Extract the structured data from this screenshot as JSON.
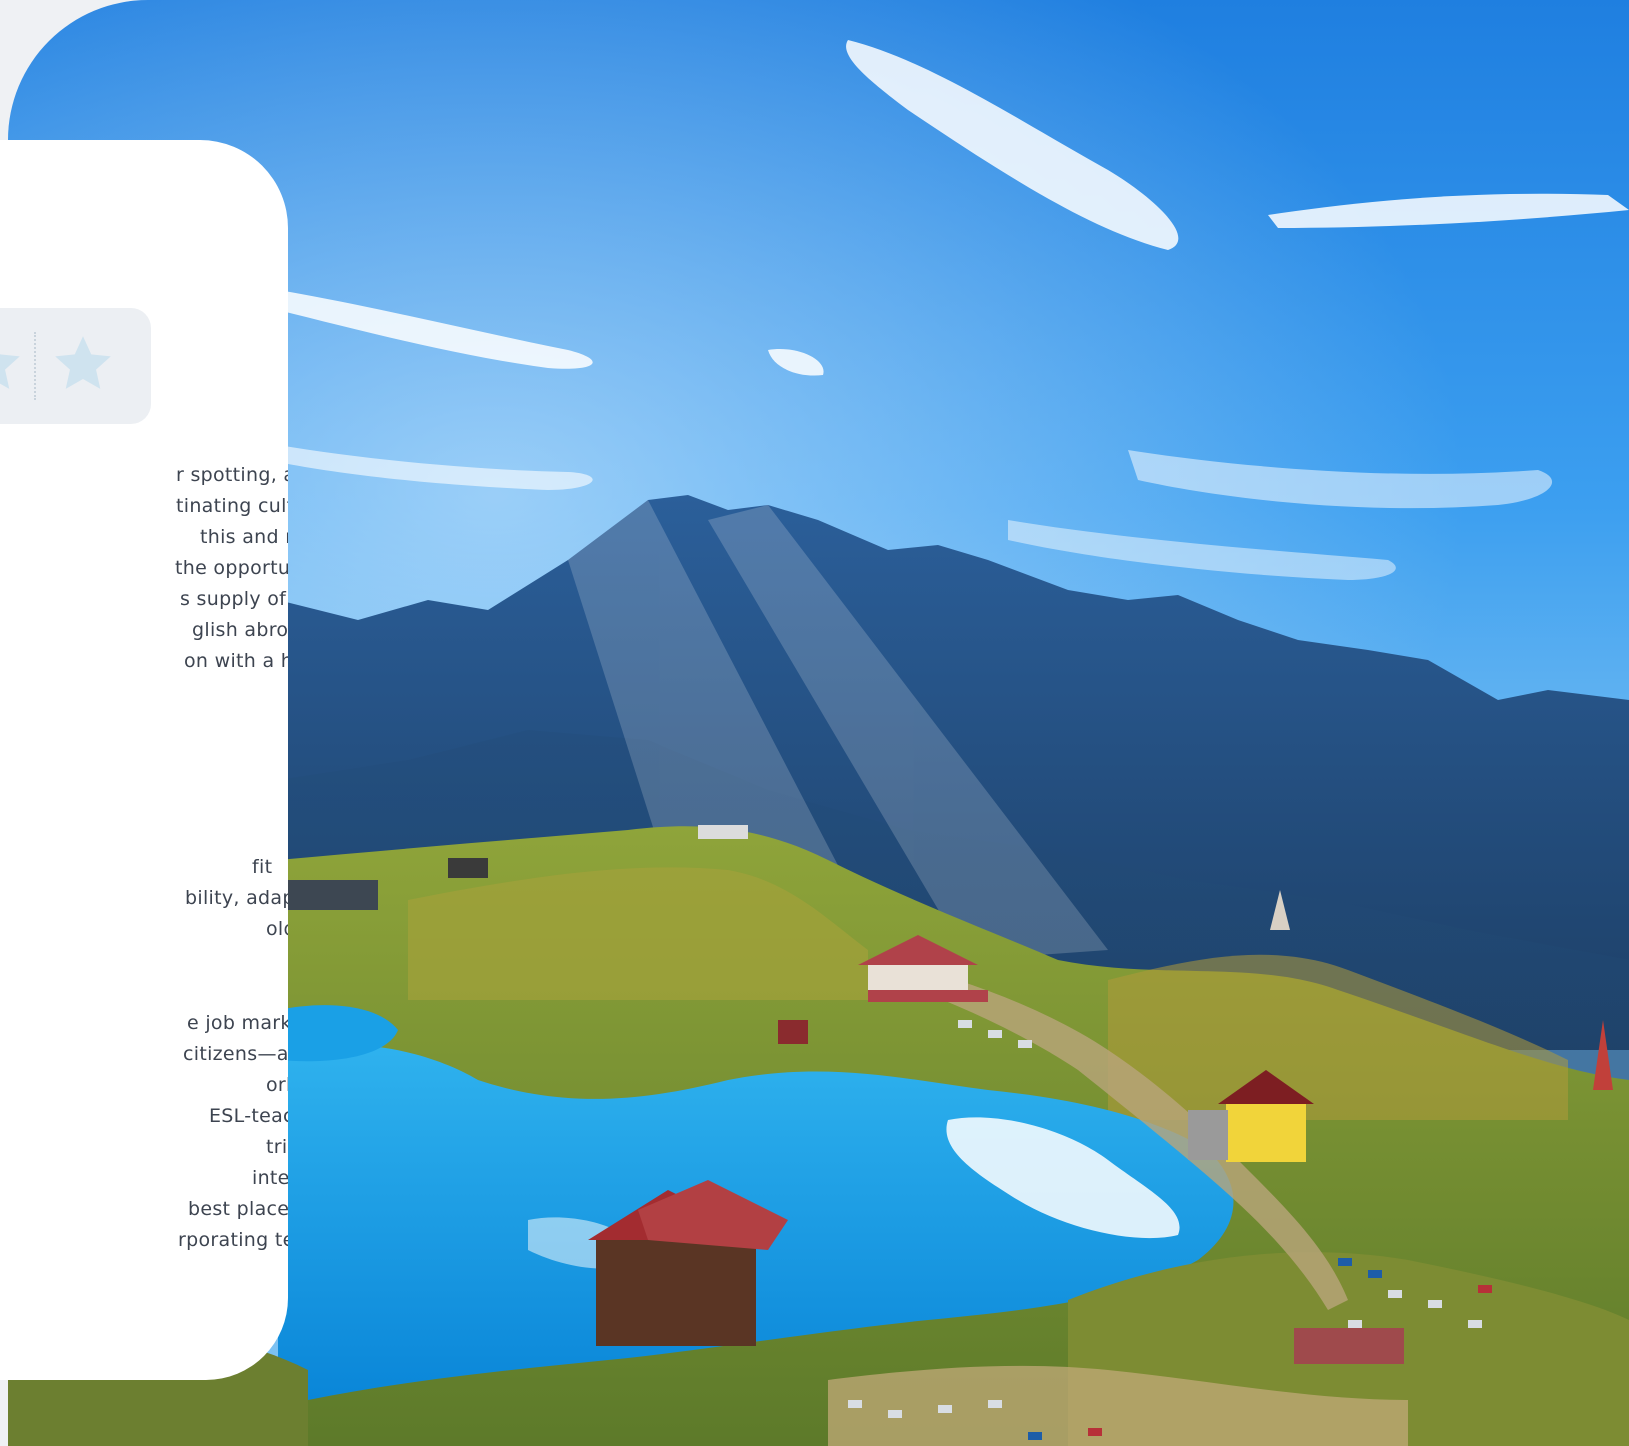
{
  "card": {
    "rating_icons": [
      "star-icon",
      "star-icon"
    ],
    "paragraph_1": [
      "r spotting, avoid",
      "tinating culture.",
      "this and make a",
      " the opportunity of",
      "s supply of sugar-",
      "glish abroad in",
      "on with a hot job"
    ],
    "paragraph_2": [
      "fit",
      "bility, adaptability",
      "olders"
    ],
    "paragraph_3": [
      "e job market is",
      " citizens—as this",
      "ork.",
      " ESL-teaching-",
      "tries will",
      " internet",
      " best places in the",
      "rporating tech into"
    ]
  },
  "colors": {
    "card_bg": "#ffffff",
    "rating_bg": "#eceff3",
    "star_color": "#cfe3ef",
    "text": "#3d4450",
    "page_bg": "#eff1f4"
  },
  "hero": {
    "subject": "mountain lake landscape photo"
  }
}
